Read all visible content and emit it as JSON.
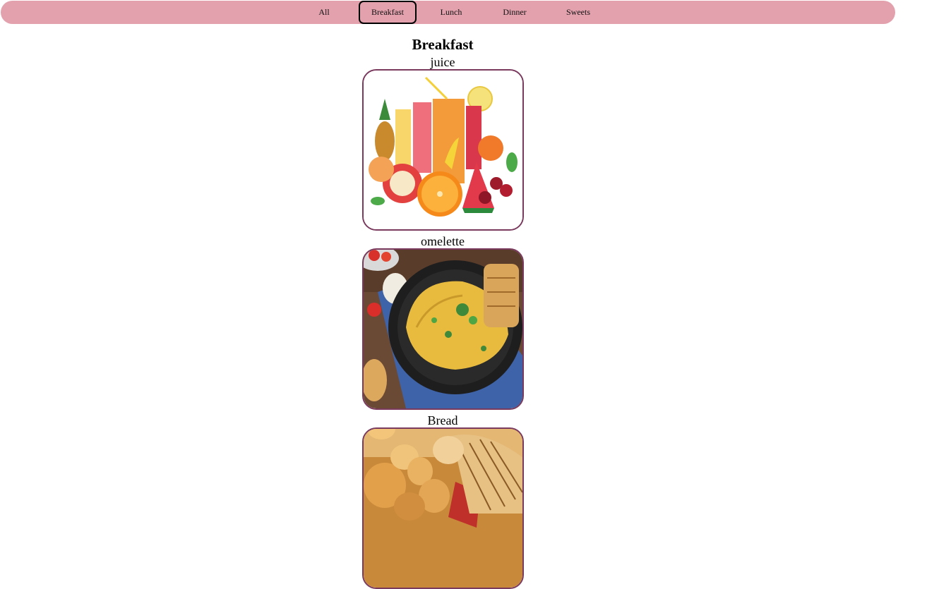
{
  "nav": {
    "items": [
      {
        "label": "All"
      },
      {
        "label": "Breakfast"
      },
      {
        "label": "Lunch"
      },
      {
        "label": "Dinner"
      },
      {
        "label": "Sweets"
      }
    ],
    "active": "Breakfast",
    "background_color": "#e2a1ad"
  },
  "section": {
    "title": "Breakfast"
  },
  "items": [
    {
      "name": "juice",
      "image_icon": "juice-image"
    },
    {
      "name": "omelette",
      "image_icon": "omelette-image"
    },
    {
      "name": "Bread",
      "image_icon": "bread-image"
    }
  ],
  "card_border_color": "#7a3a5e"
}
